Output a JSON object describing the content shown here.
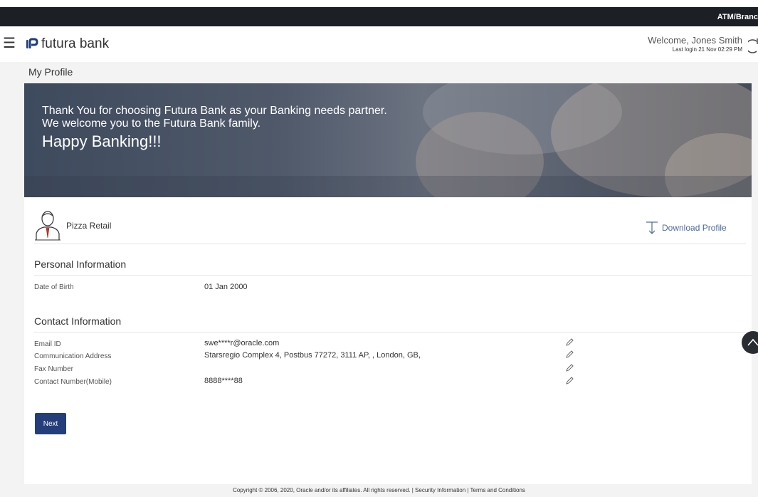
{
  "top_bar": {
    "atm_label": "ATM/Branc"
  },
  "header": {
    "logo_text": "futura bank",
    "welcome_text": "Welcome, Jones Smith",
    "last_login": "Last login 21 Nov 02:29 PM"
  },
  "page": {
    "title": "My Profile"
  },
  "banner": {
    "line1": "Thank You for choosing Futura Bank as your Banking needs partner.",
    "line2": "We welcome you to the Futura Bank family.",
    "line3": "Happy Banking!!!"
  },
  "profile": {
    "name": "Pizza Retail",
    "download_label": "Download Profile"
  },
  "personal": {
    "title": "Personal Information",
    "dob_label": "Date of Birth",
    "dob_value": "01 Jan 2000"
  },
  "contact": {
    "title": "Contact Information",
    "rows": [
      {
        "label": "Email ID",
        "value": "swe****r@oracle.com"
      },
      {
        "label": "Communication Address",
        "value": "Starsregio Complex 4, Postbus 77272, 3111 AP, , London, GB,"
      },
      {
        "label": "Fax Number",
        "value": ""
      },
      {
        "label": "Contact Number(Mobile)",
        "value": "8888****88"
      }
    ]
  },
  "actions": {
    "next_label": "Next"
  },
  "footer": {
    "text": "Copyright © 2006, 2020, Oracle and/or its affiliates. All rights reserved. | Security Information | Terms and Conditions"
  },
  "colors": {
    "top_bar": "#1d1f26",
    "primary_button": "#233e7a",
    "link": "#4b6a9c",
    "logo_accent": "#1f3b7a"
  },
  "icons": [
    "menu-icon",
    "logo-icon",
    "power-icon",
    "avatar-icon",
    "download-icon",
    "edit-icon",
    "chevron-up-icon"
  ]
}
